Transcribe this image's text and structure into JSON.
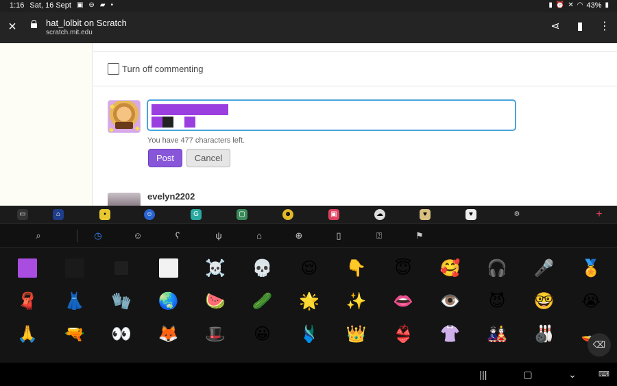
{
  "status_bar": {
    "time": "1:16",
    "date": "Sat, 16 Sept",
    "battery": "43%"
  },
  "browser": {
    "title": "hat_lolbit on Scratch",
    "url": "scratch.mit.edu"
  },
  "comment_section": {
    "toggle_label": "Turn off commenting",
    "chars_left": "You have 477 characters left.",
    "post_label": "Post",
    "cancel_label": "Cancel",
    "reply_username": "evelyn2202",
    "comment_rows": [
      [
        "#9b3ee0",
        "#9b3ee0",
        "#9b3ee0",
        "#9b3ee0",
        "#9b3ee0",
        "#9b3ee0",
        "#9b3ee0"
      ],
      [
        "#9b3ee0",
        "#222222",
        "#ffffff",
        "#9b3ee0"
      ]
    ]
  },
  "keyboard": {
    "categories": [
      "search-icon",
      "recent-icon",
      "smiley-icon",
      "animal-icon",
      "food-icon",
      "home-icon",
      "ball-icon",
      "object-icon",
      "symbol-icon",
      "flag-icon"
    ],
    "emoji_rows": [
      [
        "🟪",
        "⬛",
        "◼️",
        "⬜",
        "☠️",
        "💀",
        "😌",
        "👇",
        "😇",
        "🥰",
        "🎧",
        "🎤",
        "🏅"
      ],
      [
        "🧣",
        "👗",
        "🧤",
        "🌏",
        "🍉",
        "🥒",
        "🌟",
        "✨",
        "👄",
        "👁️",
        "😈",
        "🤓",
        "😭"
      ],
      [
        "🙏",
        "🔫",
        "👀",
        "🦊",
        "🎩",
        "😀",
        "🩱",
        "👑",
        "👙",
        "👚",
        "🎎",
        "🎳",
        "🚤"
      ]
    ]
  },
  "colors": {
    "accent": "#8756d9",
    "focus": "#4aa3df"
  }
}
